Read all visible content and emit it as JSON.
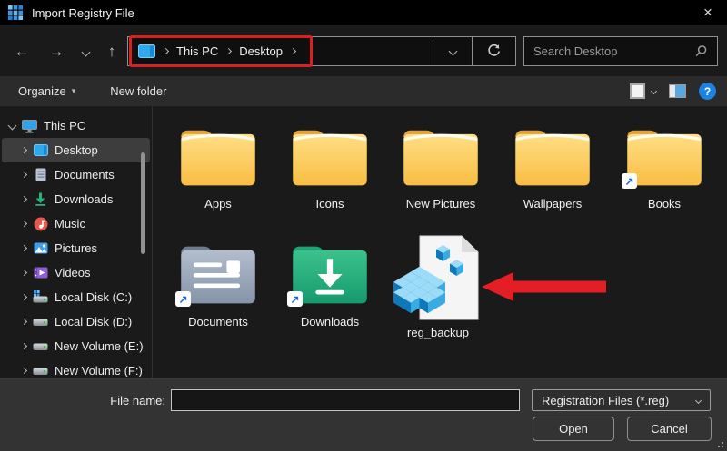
{
  "window": {
    "title": "Import Registry File",
    "close_glyph": "×"
  },
  "navigation": {
    "back_glyph": "←",
    "forward_glyph": "→",
    "up_glyph": "↑",
    "breadcrumb": {
      "this_pc": "This PC",
      "desktop": "Desktop"
    },
    "search_placeholder": "Search Desktop"
  },
  "toolbar": {
    "organize_label": "Organize",
    "organize_caret": "▾",
    "new_folder_label": "New folder",
    "help_glyph": "?"
  },
  "sidebar": {
    "items": [
      {
        "label": "This PC",
        "expanded": true
      },
      {
        "label": "Desktop",
        "selected": true
      },
      {
        "label": "Documents"
      },
      {
        "label": "Downloads"
      },
      {
        "label": "Music"
      },
      {
        "label": "Pictures"
      },
      {
        "label": "Videos"
      },
      {
        "label": "Local Disk (C:)"
      },
      {
        "label": "Local Disk (D:)"
      },
      {
        "label": "New Volume (E:)"
      },
      {
        "label": "New Volume (F:)"
      }
    ]
  },
  "files": {
    "items": [
      {
        "label": "Apps",
        "type": "folder"
      },
      {
        "label": "Icons",
        "type": "folder"
      },
      {
        "label": "New Pictures",
        "type": "folder"
      },
      {
        "label": "Wallpapers",
        "type": "folder"
      },
      {
        "label": "Books",
        "type": "folder-shortcut"
      },
      {
        "label": "Documents",
        "type": "documents-folder-shortcut"
      },
      {
        "label": "Downloads",
        "type": "downloads-folder-shortcut"
      },
      {
        "label": "reg_backup",
        "type": "registry-file"
      }
    ],
    "shortcut_glyph": "↗"
  },
  "annotations": {
    "highlight_box_target": "breadcrumb This PC > Desktop",
    "arrow_target": "reg_backup",
    "accent_red": "#d91f1f"
  },
  "colors": {
    "folder_yellow": "#ffcb52",
    "downloads_green": "#25b27c",
    "registry_blue": "#38abe3",
    "selection_gray": "#3d3d3d",
    "help_blue": "#1d83e2"
  },
  "footer": {
    "file_name_label": "File name:",
    "file_name_value": "",
    "file_type_value": "Registration Files (*.reg)",
    "open_label": "Open",
    "cancel_label": "Cancel"
  }
}
